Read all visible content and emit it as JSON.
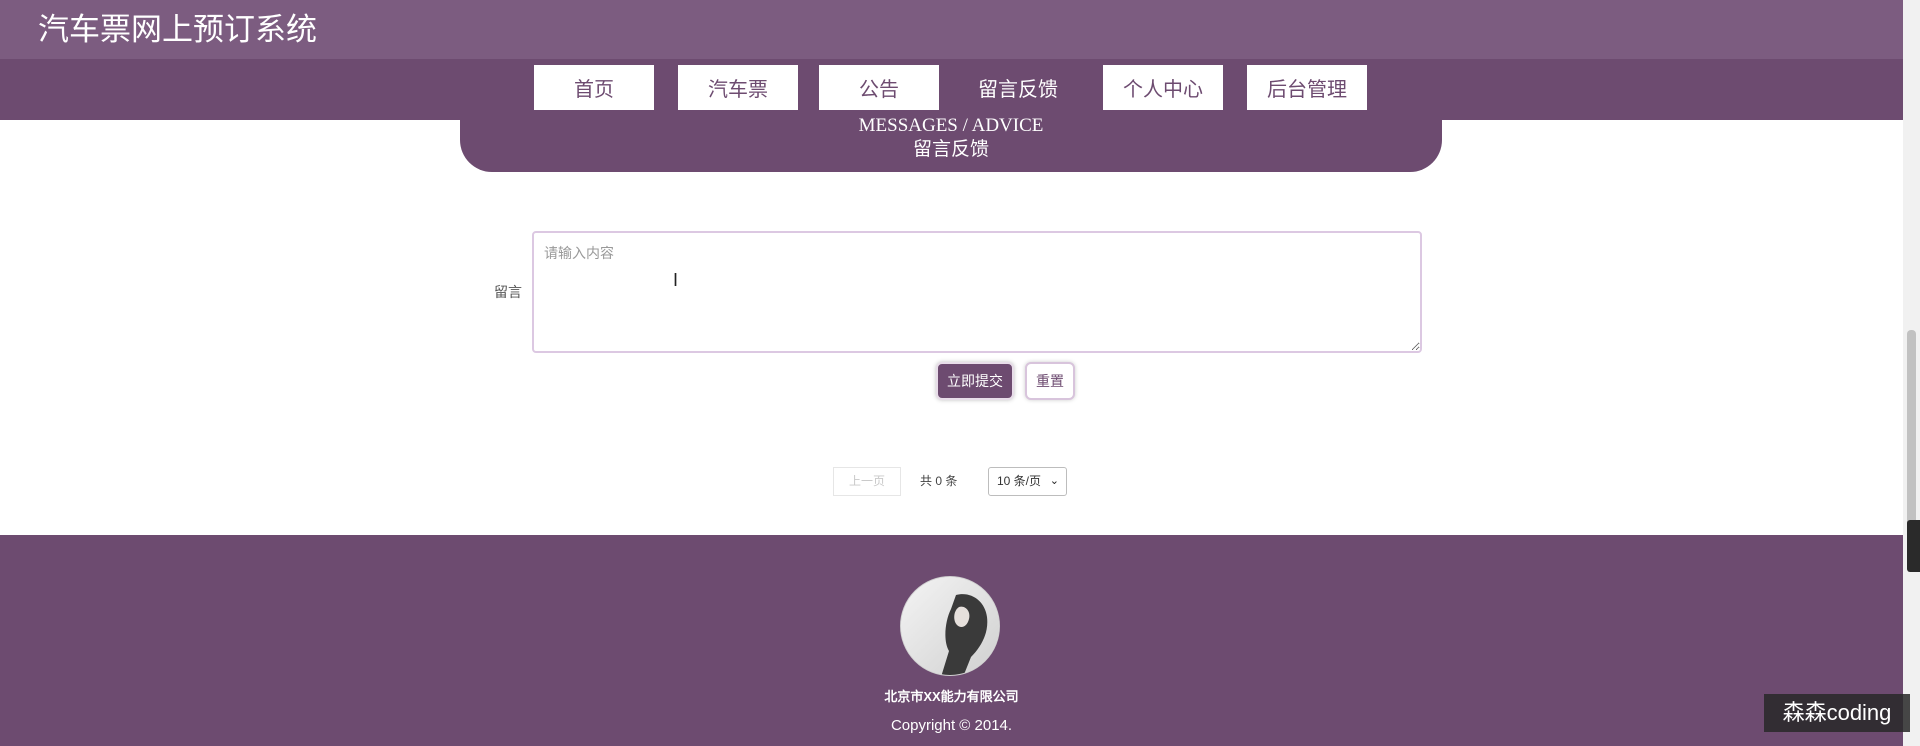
{
  "header": {
    "site_title": "汽车票网上预订系统"
  },
  "nav": {
    "items": [
      {
        "label": "首页",
        "active": false
      },
      {
        "label": "汽车票",
        "active": false
      },
      {
        "label": "公告",
        "active": false
      },
      {
        "label": "留言反馈",
        "active": true
      },
      {
        "label": "个人中心",
        "active": false
      },
      {
        "label": "后台管理",
        "active": false
      }
    ]
  },
  "section": {
    "title_en": "MESSAGES / ADVICE",
    "title_cn": "留言反馈"
  },
  "form": {
    "message_label": "留言",
    "message_placeholder": "请输入内容",
    "message_value": "",
    "submit_label": "立即提交",
    "reset_label": "重置"
  },
  "pagination": {
    "prev_label": "上一页",
    "total_text": "共 0 条",
    "page_size_value": "10 条/页"
  },
  "footer": {
    "company": "北京市XX能力有限公司",
    "copyright": "Copyright © 2014."
  },
  "overlay": {
    "watermark": "森森coding"
  },
  "colors": {
    "topbar": "#7c5c80",
    "primary": "#6d4b70",
    "text_light": "#ffffff"
  },
  "icons": {
    "text_cursor": "text-cursor-icon",
    "dropdown": "chevron-down-icon",
    "avatar": "avatar-image"
  }
}
